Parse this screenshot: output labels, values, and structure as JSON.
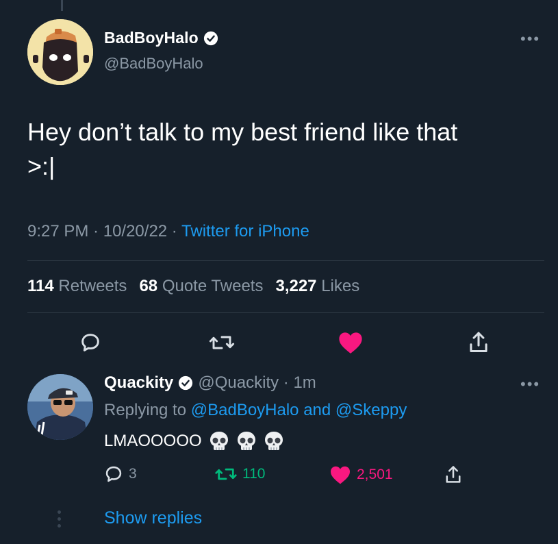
{
  "tweet": {
    "author_name": "BadBoyHalo",
    "author_handle": "@BadBoyHalo",
    "text_line1": "Hey don’t talk to my best friend like that",
    "text_line2": ">:|",
    "time": "9:27 PM",
    "sep1": " · ",
    "date": "10/20/22",
    "sep2": " · ",
    "source": "Twitter for iPhone",
    "more": "•••"
  },
  "stats": {
    "retweets_count": "114",
    "retweets_label": "Retweets",
    "quotes_count": "68",
    "quotes_label": "Quote Tweets",
    "likes_count": "3,227",
    "likes_label": "Likes"
  },
  "actions": {
    "reply": "reply-icon",
    "retweet": "retweet-icon",
    "like": "heart-filled-icon",
    "share": "share-icon"
  },
  "reply": {
    "author_name": "Quackity",
    "author_handle": "@Quackity",
    "sep": " · ",
    "time": "1m",
    "replying_prefix": "Replying to",
    "mention1": "@BadBoyHalo",
    "and": "and",
    "mention2": "@Skeppy",
    "text": "LMAOOOOO",
    "emoji": "💀",
    "reply_count": "3",
    "retweet_count": "110",
    "like_count": "2,501",
    "more": "•••"
  },
  "show_replies": "Show replies",
  "colors": {
    "background": "#16202b",
    "accent": "#1d9bf0",
    "like": "#f91880",
    "retweet": "#00ba7c",
    "muted": "#8b98a5"
  }
}
